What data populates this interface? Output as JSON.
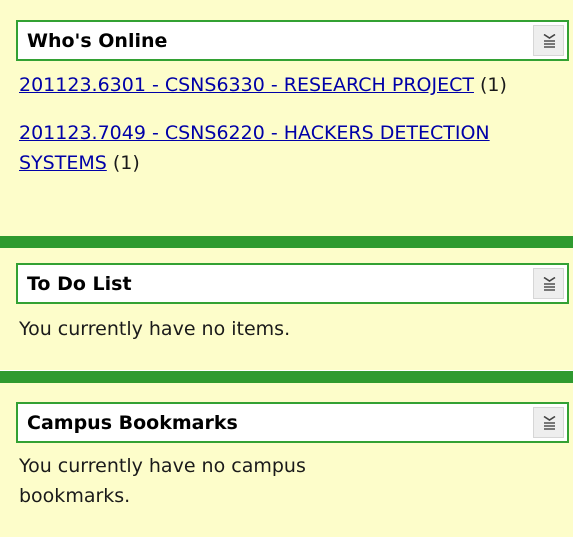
{
  "colors": {
    "panel_background": "#fdfdca",
    "divider": "#2f9a2f",
    "header_border": "#33a133",
    "link": "#0000a8"
  },
  "whos_online": {
    "title": "Who's Online",
    "collapse_icon": "collapse-lines-icon",
    "items": [
      {
        "link": "201123.6301 - CSNS6330 - RESEARCH PROJECT",
        "count": " (1)"
      },
      {
        "link": "201123.7049 - CSNS6220 - HACKERS DETECTION SYSTEMS",
        "count": " (1)"
      }
    ]
  },
  "todo": {
    "title": "To Do List",
    "collapse_icon": "collapse-lines-icon",
    "message": "You currently have no items."
  },
  "bookmarks": {
    "title": "Campus Bookmarks",
    "collapse_icon": "collapse-lines-icon",
    "message": "You currently have no campus bookmarks."
  }
}
